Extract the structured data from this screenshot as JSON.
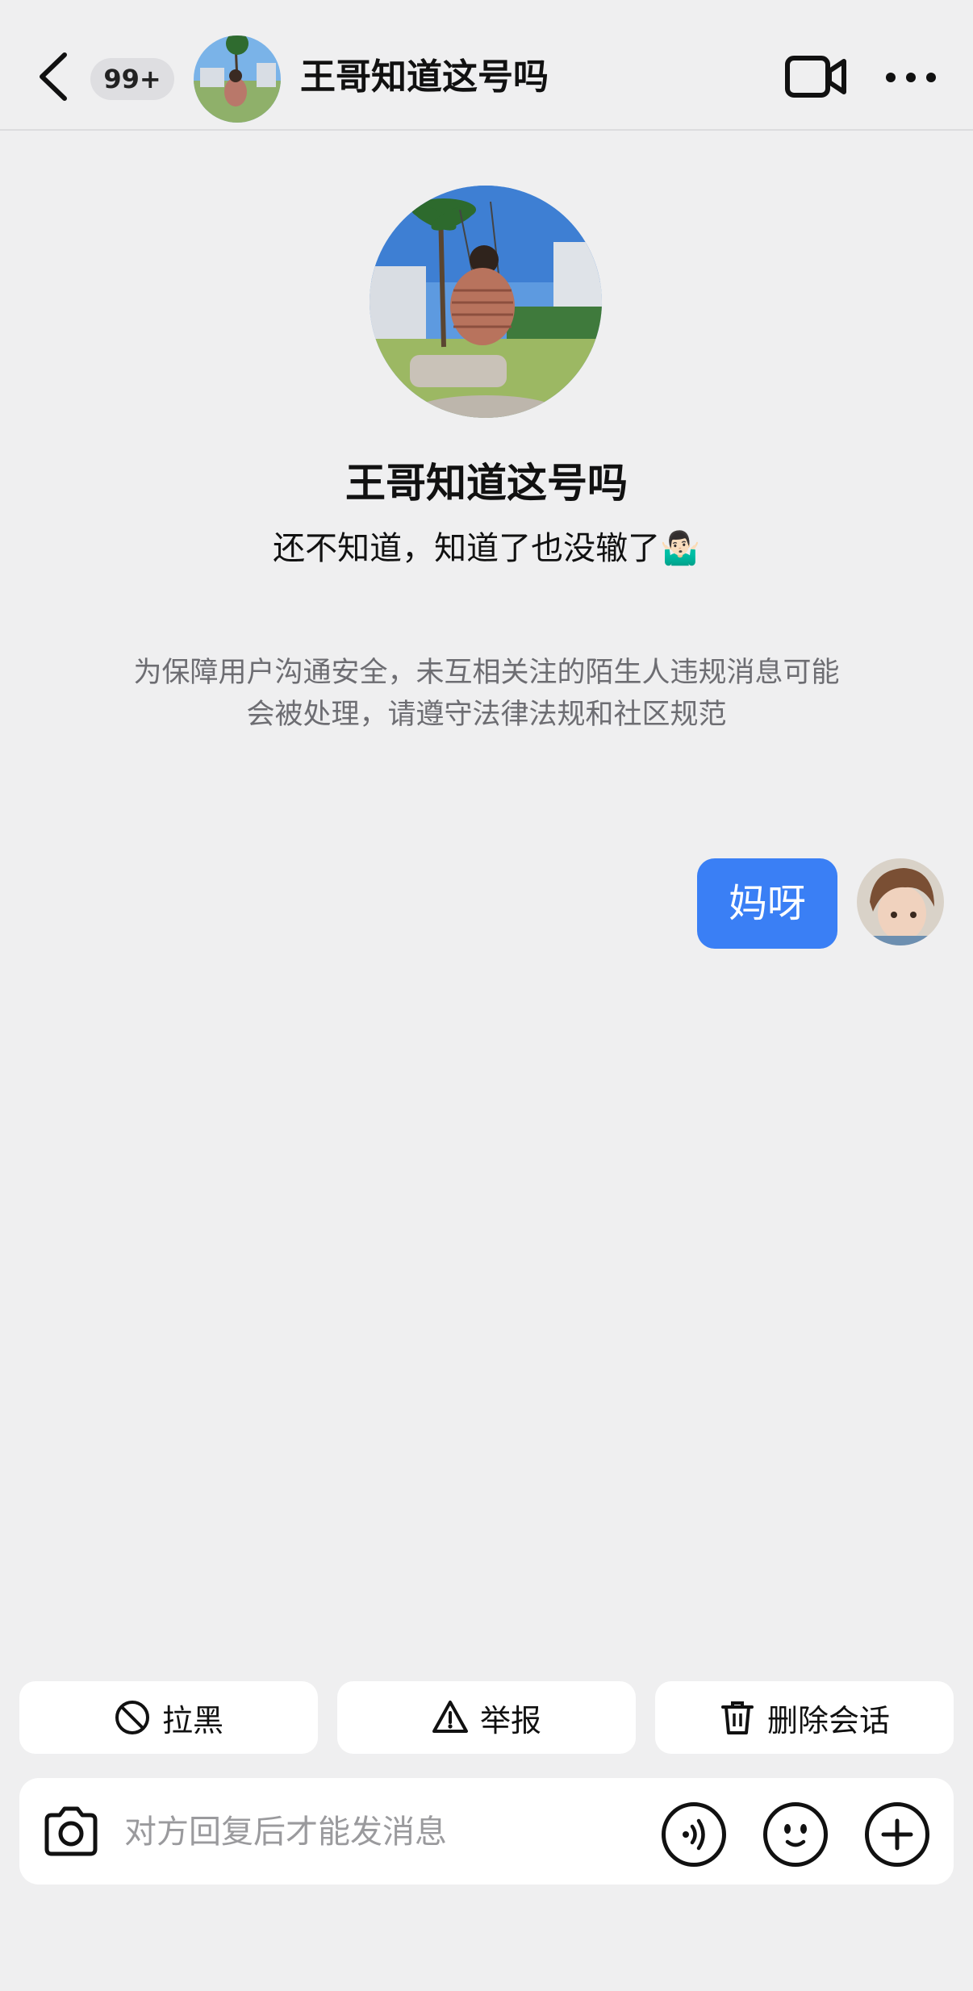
{
  "header": {
    "back_label": "Back",
    "unread_badge": "99+",
    "title": "王哥知道这号吗",
    "video_icon": "video-camera-icon",
    "more_icon": "more-dots-icon"
  },
  "profile": {
    "name": "王哥知道这号吗",
    "bio": "还不知道，知道了也没辙了🤷🏻‍♂️"
  },
  "notice": {
    "line1": "为保障用户沟通安全，未互相关注的陌生人违规消息可能",
    "line2": "会被处理，请遵守法律法规和社区规范"
  },
  "messages": [
    {
      "from": "me",
      "text": "妈呀"
    }
  ],
  "actions": {
    "block_label": "拉黑",
    "report_label": "举报",
    "delete_label": "删除会话"
  },
  "input": {
    "placeholder": "对方回复后才能发消息"
  },
  "colors": {
    "accent": "#3a7ff5",
    "background": "#efeff0",
    "notice_text": "#6d6d72"
  }
}
